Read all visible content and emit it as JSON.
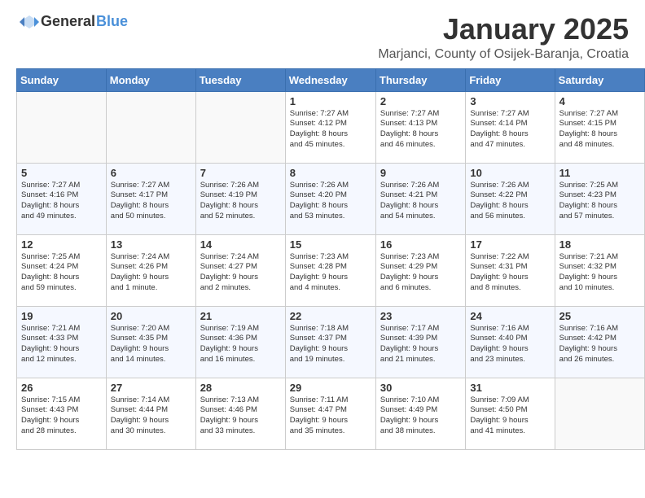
{
  "header": {
    "logo_general": "General",
    "logo_blue": "Blue",
    "title": "January 2025",
    "subtitle": "Marjanci, County of Osijek-Baranja, Croatia"
  },
  "weekdays": [
    "Sunday",
    "Monday",
    "Tuesday",
    "Wednesday",
    "Thursday",
    "Friday",
    "Saturday"
  ],
  "weeks": [
    [
      {
        "day": null,
        "info": ""
      },
      {
        "day": null,
        "info": ""
      },
      {
        "day": null,
        "info": ""
      },
      {
        "day": "1",
        "info": "Sunrise: 7:27 AM\nSunset: 4:12 PM\nDaylight: 8 hours\nand 45 minutes."
      },
      {
        "day": "2",
        "info": "Sunrise: 7:27 AM\nSunset: 4:13 PM\nDaylight: 8 hours\nand 46 minutes."
      },
      {
        "day": "3",
        "info": "Sunrise: 7:27 AM\nSunset: 4:14 PM\nDaylight: 8 hours\nand 47 minutes."
      },
      {
        "day": "4",
        "info": "Sunrise: 7:27 AM\nSunset: 4:15 PM\nDaylight: 8 hours\nand 48 minutes."
      }
    ],
    [
      {
        "day": "5",
        "info": "Sunrise: 7:27 AM\nSunset: 4:16 PM\nDaylight: 8 hours\nand 49 minutes."
      },
      {
        "day": "6",
        "info": "Sunrise: 7:27 AM\nSunset: 4:17 PM\nDaylight: 8 hours\nand 50 minutes."
      },
      {
        "day": "7",
        "info": "Sunrise: 7:26 AM\nSunset: 4:19 PM\nDaylight: 8 hours\nand 52 minutes."
      },
      {
        "day": "8",
        "info": "Sunrise: 7:26 AM\nSunset: 4:20 PM\nDaylight: 8 hours\nand 53 minutes."
      },
      {
        "day": "9",
        "info": "Sunrise: 7:26 AM\nSunset: 4:21 PM\nDaylight: 8 hours\nand 54 minutes."
      },
      {
        "day": "10",
        "info": "Sunrise: 7:26 AM\nSunset: 4:22 PM\nDaylight: 8 hours\nand 56 minutes."
      },
      {
        "day": "11",
        "info": "Sunrise: 7:25 AM\nSunset: 4:23 PM\nDaylight: 8 hours\nand 57 minutes."
      }
    ],
    [
      {
        "day": "12",
        "info": "Sunrise: 7:25 AM\nSunset: 4:24 PM\nDaylight: 8 hours\nand 59 minutes."
      },
      {
        "day": "13",
        "info": "Sunrise: 7:24 AM\nSunset: 4:26 PM\nDaylight: 9 hours\nand 1 minute."
      },
      {
        "day": "14",
        "info": "Sunrise: 7:24 AM\nSunset: 4:27 PM\nDaylight: 9 hours\nand 2 minutes."
      },
      {
        "day": "15",
        "info": "Sunrise: 7:23 AM\nSunset: 4:28 PM\nDaylight: 9 hours\nand 4 minutes."
      },
      {
        "day": "16",
        "info": "Sunrise: 7:23 AM\nSunset: 4:29 PM\nDaylight: 9 hours\nand 6 minutes."
      },
      {
        "day": "17",
        "info": "Sunrise: 7:22 AM\nSunset: 4:31 PM\nDaylight: 9 hours\nand 8 minutes."
      },
      {
        "day": "18",
        "info": "Sunrise: 7:21 AM\nSunset: 4:32 PM\nDaylight: 9 hours\nand 10 minutes."
      }
    ],
    [
      {
        "day": "19",
        "info": "Sunrise: 7:21 AM\nSunset: 4:33 PM\nDaylight: 9 hours\nand 12 minutes."
      },
      {
        "day": "20",
        "info": "Sunrise: 7:20 AM\nSunset: 4:35 PM\nDaylight: 9 hours\nand 14 minutes."
      },
      {
        "day": "21",
        "info": "Sunrise: 7:19 AM\nSunset: 4:36 PM\nDaylight: 9 hours\nand 16 minutes."
      },
      {
        "day": "22",
        "info": "Sunrise: 7:18 AM\nSunset: 4:37 PM\nDaylight: 9 hours\nand 19 minutes."
      },
      {
        "day": "23",
        "info": "Sunrise: 7:17 AM\nSunset: 4:39 PM\nDaylight: 9 hours\nand 21 minutes."
      },
      {
        "day": "24",
        "info": "Sunrise: 7:16 AM\nSunset: 4:40 PM\nDaylight: 9 hours\nand 23 minutes."
      },
      {
        "day": "25",
        "info": "Sunrise: 7:16 AM\nSunset: 4:42 PM\nDaylight: 9 hours\nand 26 minutes."
      }
    ],
    [
      {
        "day": "26",
        "info": "Sunrise: 7:15 AM\nSunset: 4:43 PM\nDaylight: 9 hours\nand 28 minutes."
      },
      {
        "day": "27",
        "info": "Sunrise: 7:14 AM\nSunset: 4:44 PM\nDaylight: 9 hours\nand 30 minutes."
      },
      {
        "day": "28",
        "info": "Sunrise: 7:13 AM\nSunset: 4:46 PM\nDaylight: 9 hours\nand 33 minutes."
      },
      {
        "day": "29",
        "info": "Sunrise: 7:11 AM\nSunset: 4:47 PM\nDaylight: 9 hours\nand 35 minutes."
      },
      {
        "day": "30",
        "info": "Sunrise: 7:10 AM\nSunset: 4:49 PM\nDaylight: 9 hours\nand 38 minutes."
      },
      {
        "day": "31",
        "info": "Sunrise: 7:09 AM\nSunset: 4:50 PM\nDaylight: 9 hours\nand 41 minutes."
      },
      {
        "day": null,
        "info": ""
      }
    ]
  ]
}
